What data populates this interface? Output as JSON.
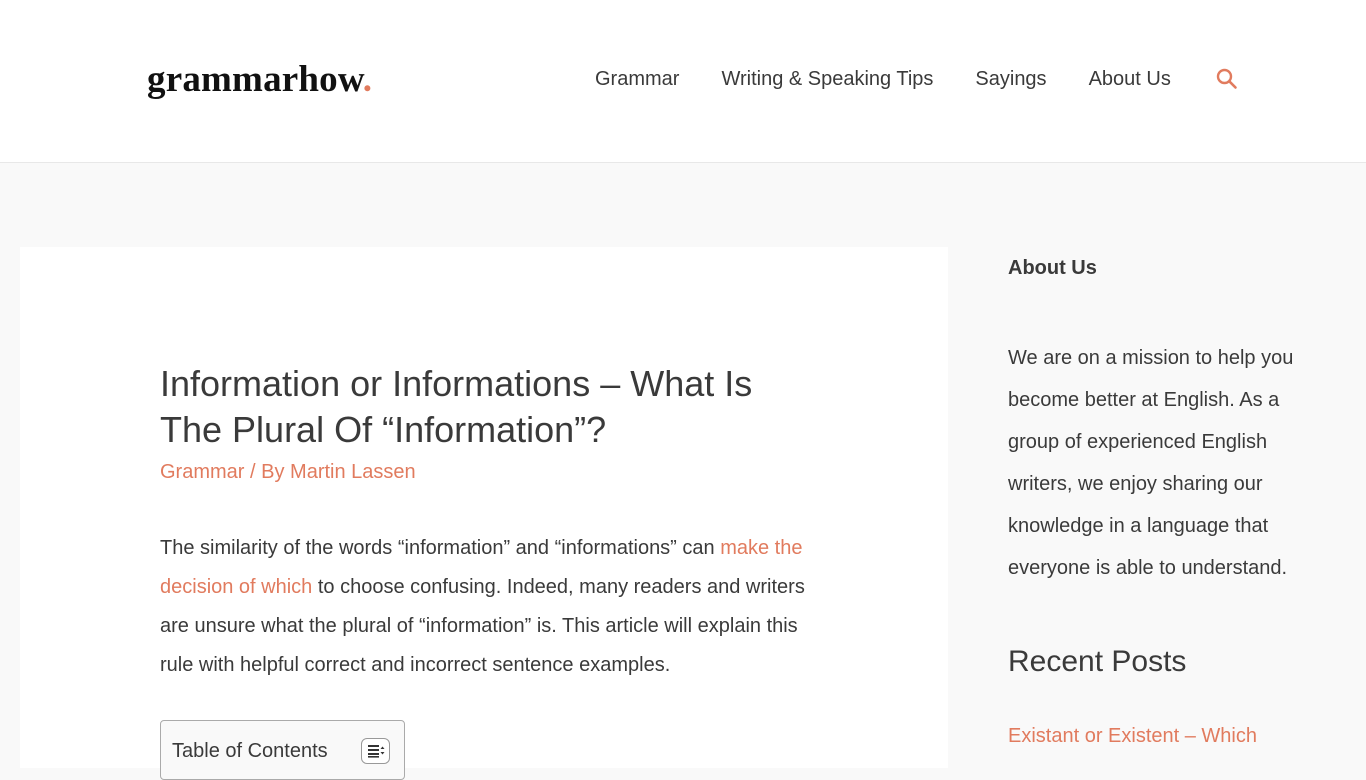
{
  "header": {
    "logo_text": "grammarhow",
    "logo_dot": ".",
    "nav": [
      {
        "label": "Grammar"
      },
      {
        "label": "Writing & Speaking Tips"
      },
      {
        "label": "Sayings"
      },
      {
        "label": "About Us"
      }
    ],
    "search_icon": "search-icon"
  },
  "article": {
    "title": "Information or Informations – What Is The Plural Of “Information”?",
    "meta": {
      "category": "Grammar",
      "separator": " / By ",
      "author": "Martin Lassen"
    },
    "intro": {
      "text_before": "The similarity of the words “information” and “informations” can ",
      "link_text": "make the decision of which",
      "text_after": " to choose confusing. Indeed, many readers and writers are unsure what the plural of “information” is. This article will explain this rule with helpful correct and incorrect sentence examples."
    },
    "toc": {
      "title": "Table of Contents",
      "toggle_icon": "list-toggle-icon"
    }
  },
  "sidebar": {
    "about": {
      "title": "About Us",
      "text": "We are on a mission to help you become better at English. As a group of experienced English writers, we enjoy sharing our knowledge in a language that everyone is able to understand."
    },
    "recent_posts": {
      "title": "Recent Posts",
      "items": [
        {
          "label": "Existant or Existent – Which"
        }
      ]
    }
  },
  "colors": {
    "accent": "#e17b5e",
    "text": "#3a3a3a",
    "background": "#f9f9f9",
    "card": "#ffffff"
  }
}
